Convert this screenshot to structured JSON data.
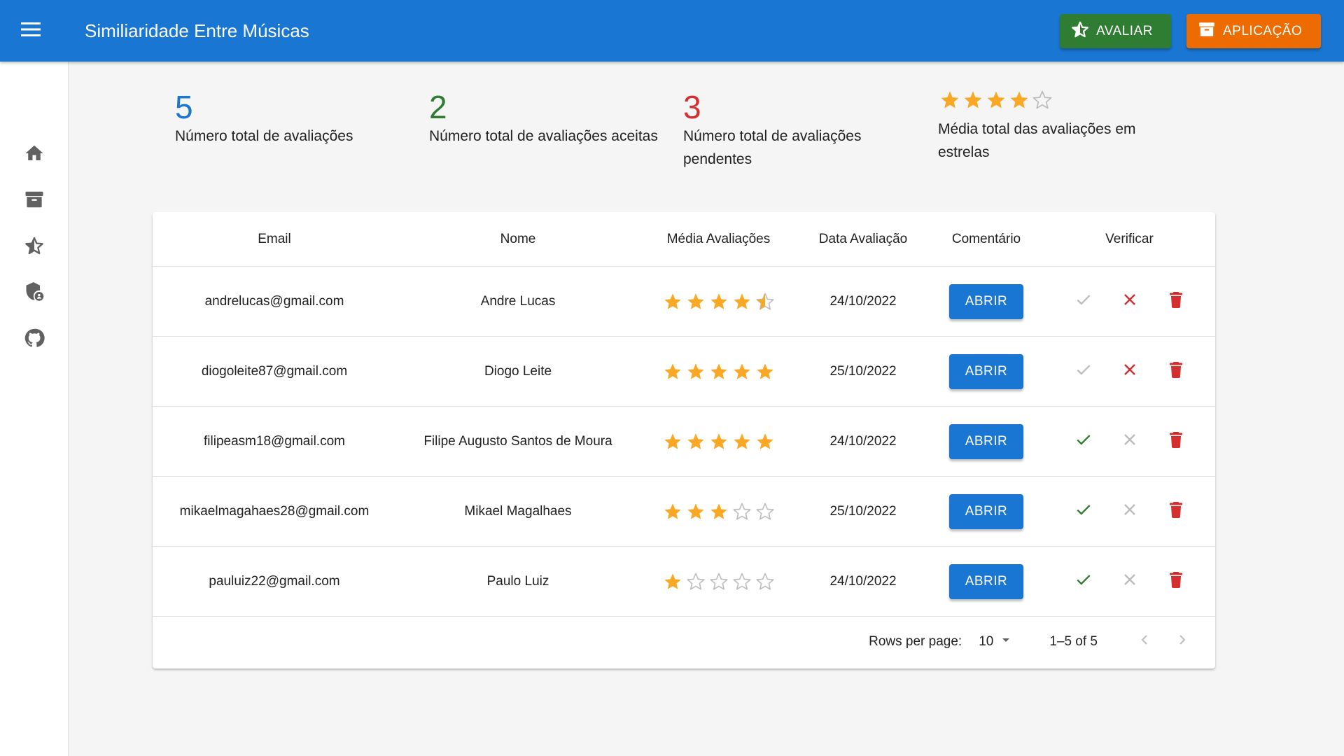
{
  "app": {
    "title": "Similiaridade Entre Músicas",
    "avaliar_label": "AVALIAR",
    "aplicacao_label": "APLICAÇÃO"
  },
  "sidebar": {
    "items": [
      {
        "icon": "home-icon"
      },
      {
        "icon": "archive-icon"
      },
      {
        "icon": "star-icon"
      },
      {
        "icon": "security-icon"
      },
      {
        "icon": "github-icon"
      }
    ]
  },
  "stats": {
    "total": {
      "value": "5",
      "label": "Número total de avaliações",
      "color": "#1976d2"
    },
    "aceitas": {
      "value": "2",
      "label": "Número total de avaliações aceitas",
      "color": "#2e7d32"
    },
    "pendentes": {
      "value": "3",
      "label_line1": "Número total de avaliações",
      "label_line2": "pendentes",
      "color": "#d32f2f"
    },
    "media": {
      "rating": 4,
      "label_line1": "Média total das avaliações em",
      "label_line2": "estrelas"
    }
  },
  "table": {
    "headers": {
      "email": "Email",
      "nome": "Nome",
      "media": "Média Avaliações",
      "data": "Data Avaliação",
      "comentario": "Comentário",
      "verificar": "Verificar"
    },
    "abrir_label": "ABRIR",
    "rows": [
      {
        "email": "andrelucas@gmail.com",
        "nome": "Andre Lucas",
        "rating": 4.5,
        "data": "24/10/2022",
        "verified": false
      },
      {
        "email": "diogoleite87@gmail.com",
        "nome": "Diogo Leite",
        "rating": 5,
        "data": "25/10/2022",
        "verified": false
      },
      {
        "email": "filipeasm18@gmail.com",
        "nome": "Filipe Augusto Santos de Moura",
        "rating": 5,
        "data": "24/10/2022",
        "verified": true
      },
      {
        "email": "mikaelmagahaes28@gmail.com",
        "nome": "Mikael Magalhaes",
        "rating": 3,
        "data": "25/10/2022",
        "verified": true
      },
      {
        "email": "pauluiz22@gmail.com",
        "nome": "Paulo Luiz",
        "rating": 1,
        "data": "24/10/2022",
        "verified": true
      }
    ]
  },
  "pagination": {
    "rows_per_page_label": "Rows per page:",
    "rows_per_page_value": "10",
    "range": "1–5 of 5"
  },
  "colors": {
    "primary": "#1976d2",
    "success": "#2e7d32",
    "warning": "#ed6c02",
    "error": "#d32f2f",
    "star": "#f9a825"
  }
}
